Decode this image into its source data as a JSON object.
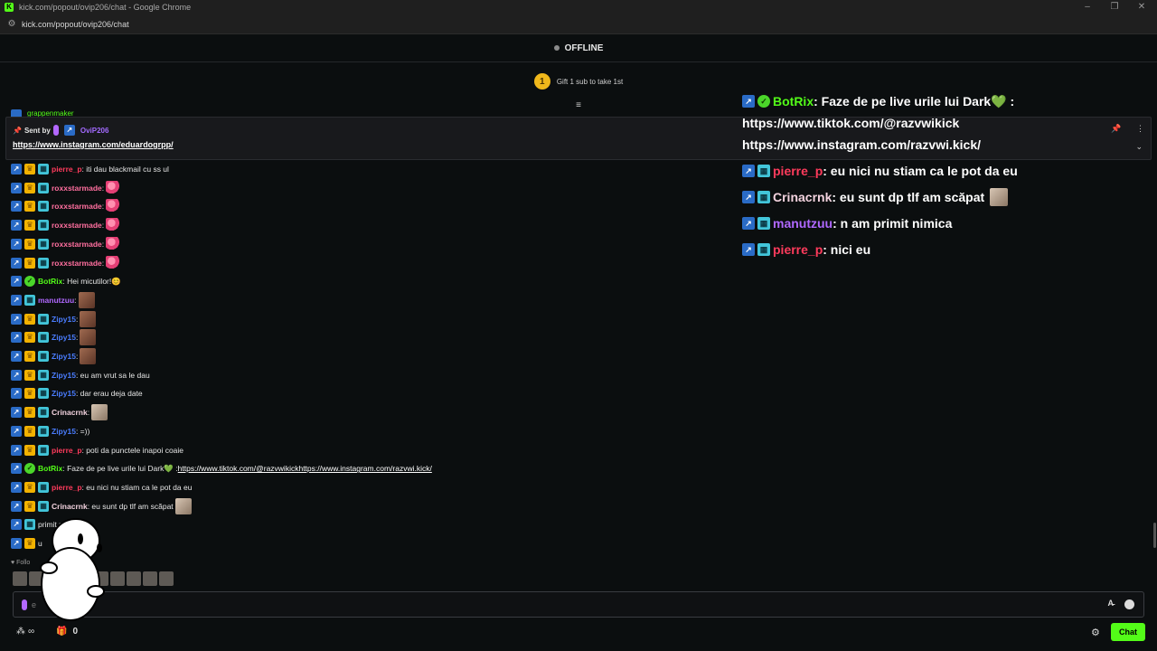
{
  "browser": {
    "title": "kick.com/popout/ovip206/chat - Google Chrome",
    "logo_letter": "K",
    "url": "kick.com/popout/ovip206/chat"
  },
  "status": {
    "label": "OFFLINE"
  },
  "gift": {
    "count": "1",
    "text": "Gift 1 sub to take 1st"
  },
  "pinned": {
    "sent_by_label": "Sent by",
    "user": "OviP206",
    "link": "https://www.instagram.com/eduardogrpp/"
  },
  "peek": {
    "text": "grappenmaker"
  },
  "messages": [
    {
      "user": "pierre_p",
      "color": "#ff3b5c",
      "badges": [
        "og",
        "crown",
        "sub"
      ],
      "text": ": iti dau blackmail cu ss ul",
      "emote": ""
    },
    {
      "user": "roxxstarmade",
      "color": "#ff6f9f",
      "badges": [
        "og",
        "crown",
        "sub"
      ],
      "text": ":",
      "emote": "heart"
    },
    {
      "user": "roxxstarmade",
      "color": "#ff6f9f",
      "badges": [
        "og",
        "crown",
        "sub"
      ],
      "text": ":",
      "emote": "heart"
    },
    {
      "user": "roxxstarmade",
      "color": "#ff6f9f",
      "badges": [
        "og",
        "crown",
        "sub"
      ],
      "text": ":",
      "emote": "heart"
    },
    {
      "user": "roxxstarmade",
      "color": "#ff6f9f",
      "badges": [
        "og",
        "crown",
        "sub"
      ],
      "text": ":",
      "emote": "heart"
    },
    {
      "user": "roxxstarmade",
      "color": "#ff6f9f",
      "badges": [
        "og",
        "crown",
        "sub"
      ],
      "text": ":",
      "emote": "heart"
    },
    {
      "user": "BotRix",
      "color": "#53fc18",
      "badges": [
        "og",
        "bot"
      ],
      "text": ": Hei micutilor!😊",
      "emote": ""
    },
    {
      "user": "manutzuu",
      "color": "#b068ff",
      "badges": [
        "og",
        "sub"
      ],
      "text": ":",
      "emote": "face"
    },
    {
      "user": "Zipy15",
      "color": "#4a7dff",
      "badges": [
        "og",
        "crown",
        "sub"
      ],
      "text": ":",
      "emote": "face"
    },
    {
      "user": "Zipy15",
      "color": "#4a7dff",
      "badges": [
        "og",
        "crown",
        "sub"
      ],
      "text": ":",
      "emote": "face"
    },
    {
      "user": "Zipy15",
      "color": "#4a7dff",
      "badges": [
        "og",
        "crown",
        "sub"
      ],
      "text": ":",
      "emote": "face"
    },
    {
      "user": "Zipy15",
      "color": "#4a7dff",
      "badges": [
        "og",
        "crown",
        "sub"
      ],
      "text": ": eu am vrut sa le dau",
      "emote": ""
    },
    {
      "user": "Zipy15",
      "color": "#4a7dff",
      "badges": [
        "og",
        "crown",
        "sub"
      ],
      "text": ": dar erau deja date",
      "emote": ""
    },
    {
      "user": "Crinacrnk",
      "color": "#f3d3df",
      "badges": [
        "og",
        "crown",
        "sub"
      ],
      "text": ":",
      "emote": "hand"
    },
    {
      "user": "Zipy15",
      "color": "#4a7dff",
      "badges": [
        "og",
        "crown",
        "sub"
      ],
      "text": ": =))",
      "emote": ""
    },
    {
      "user": "pierre_p",
      "color": "#ff3b5c",
      "badges": [
        "og",
        "crown",
        "sub"
      ],
      "text": ": poti da punctele inapoi coaie",
      "emote": ""
    },
    {
      "user": "BotRix",
      "color": "#53fc18",
      "badges": [
        "og",
        "bot"
      ],
      "text": ": Faze de pe live urile lui Dark💚 : ",
      "link1": "https://www.tiktok.com/@razvwikick",
      "link2": "https://www.instagram.com/razvwi.kick/",
      "emote": ""
    },
    {
      "user": "pierre_p",
      "color": "#ff3b5c",
      "badges": [
        "og",
        "crown",
        "sub"
      ],
      "text": ": eu nici nu stiam ca le pot da eu",
      "emote": ""
    },
    {
      "user": "Crinacrnk",
      "color": "#f3d3df",
      "badges": [
        "og",
        "crown",
        "sub"
      ],
      "text": ": eu sunt dp tlf am scăpat",
      "emote": "hand"
    },
    {
      "user": "",
      "color": "#b068ff",
      "badges": [
        "og",
        "sub"
      ],
      "text": "primit nimica",
      "emote": ""
    },
    {
      "user": "",
      "color": "#ff3b5c",
      "badges": [
        "og",
        "crown"
      ],
      "text": "u",
      "emote": ""
    }
  ],
  "followers": {
    "label": "Follo"
  },
  "input": {
    "placeholder": "e"
  },
  "footer": {
    "points": "∞",
    "gifts": "0",
    "chat_label": "Chat"
  },
  "overlay": {
    "botrix_user": "BotRix",
    "botrix_text": " : Faze de pe live urile lui Dark💚 :",
    "botrix_link1": "https://www.tiktok.com/@razvwikick",
    "botrix_link2": "https://www.instagram.com/razvwi.kick/",
    "rows": [
      {
        "user": "pierre_p",
        "color": "#ff3b5c",
        "text": " : eu nici nu stiam ca le pot da eu",
        "emote": false
      },
      {
        "user": "Crinacrnk",
        "color": "#f3d3df",
        "text": " : eu sunt dp tlf am scăpat",
        "emote": true
      },
      {
        "user": "manutzuu",
        "color": "#b068ff",
        "text": " : n am primit nimica",
        "emote": false
      },
      {
        "user": "pierre_p",
        "color": "#ff3b5c",
        "text": " : nici eu",
        "emote": false
      }
    ]
  }
}
